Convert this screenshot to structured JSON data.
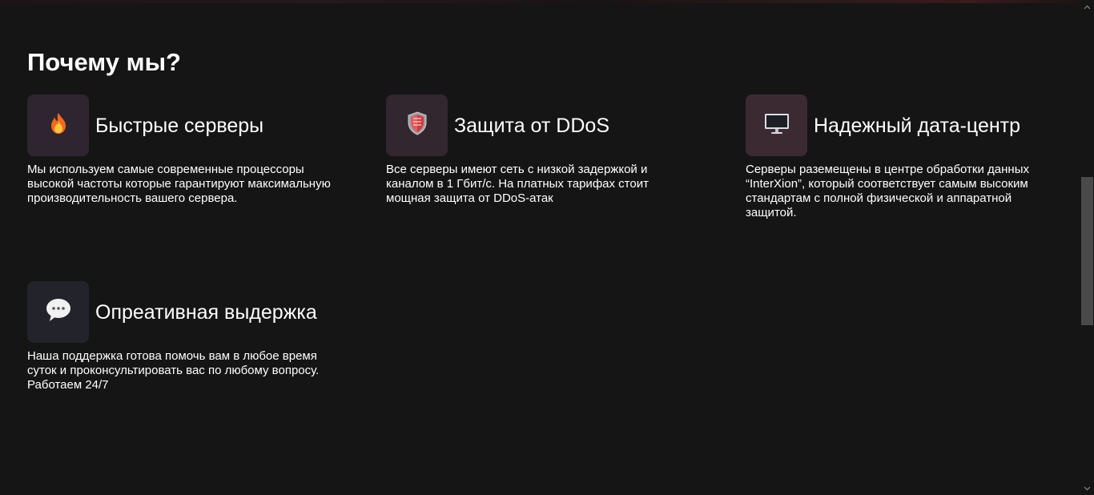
{
  "section": {
    "title": "Почему мы?"
  },
  "features": [
    {
      "icon": "fire-icon",
      "tile_color": "#2e2530",
      "title": "Быстрые серверы",
      "text": "Мы используем самые современные процессоры высокой частоты которые гарантируют максимальную производительность вашего сервера."
    },
    {
      "icon": "shield-icon",
      "tile_color": "#32262f",
      "title": "Защита от DDoS",
      "text": "Все серверы имеют сеть с низкой задержкой и каналом в 1 Гбит/с. На платных тарифах стоит мощная защита от DDoS-атак"
    },
    {
      "icon": "monitor-icon",
      "tile_color": "#3c2a33",
      "title": "Надежный дата-центр",
      "text": "Серверы раземещены в центре обработки данных “InterXion”, который соответствует самым высоким стандартам с полной физической и аппаратной защитой."
    },
    {
      "icon": "speech-bubble-icon",
      "tile_color": "#23232c",
      "title": "Опреативная выдержка",
      "text": "Наша поддержка готова помочь вам в любое время суток и проконсультировать вас по любому вопросу. Работаем 24/7"
    }
  ]
}
